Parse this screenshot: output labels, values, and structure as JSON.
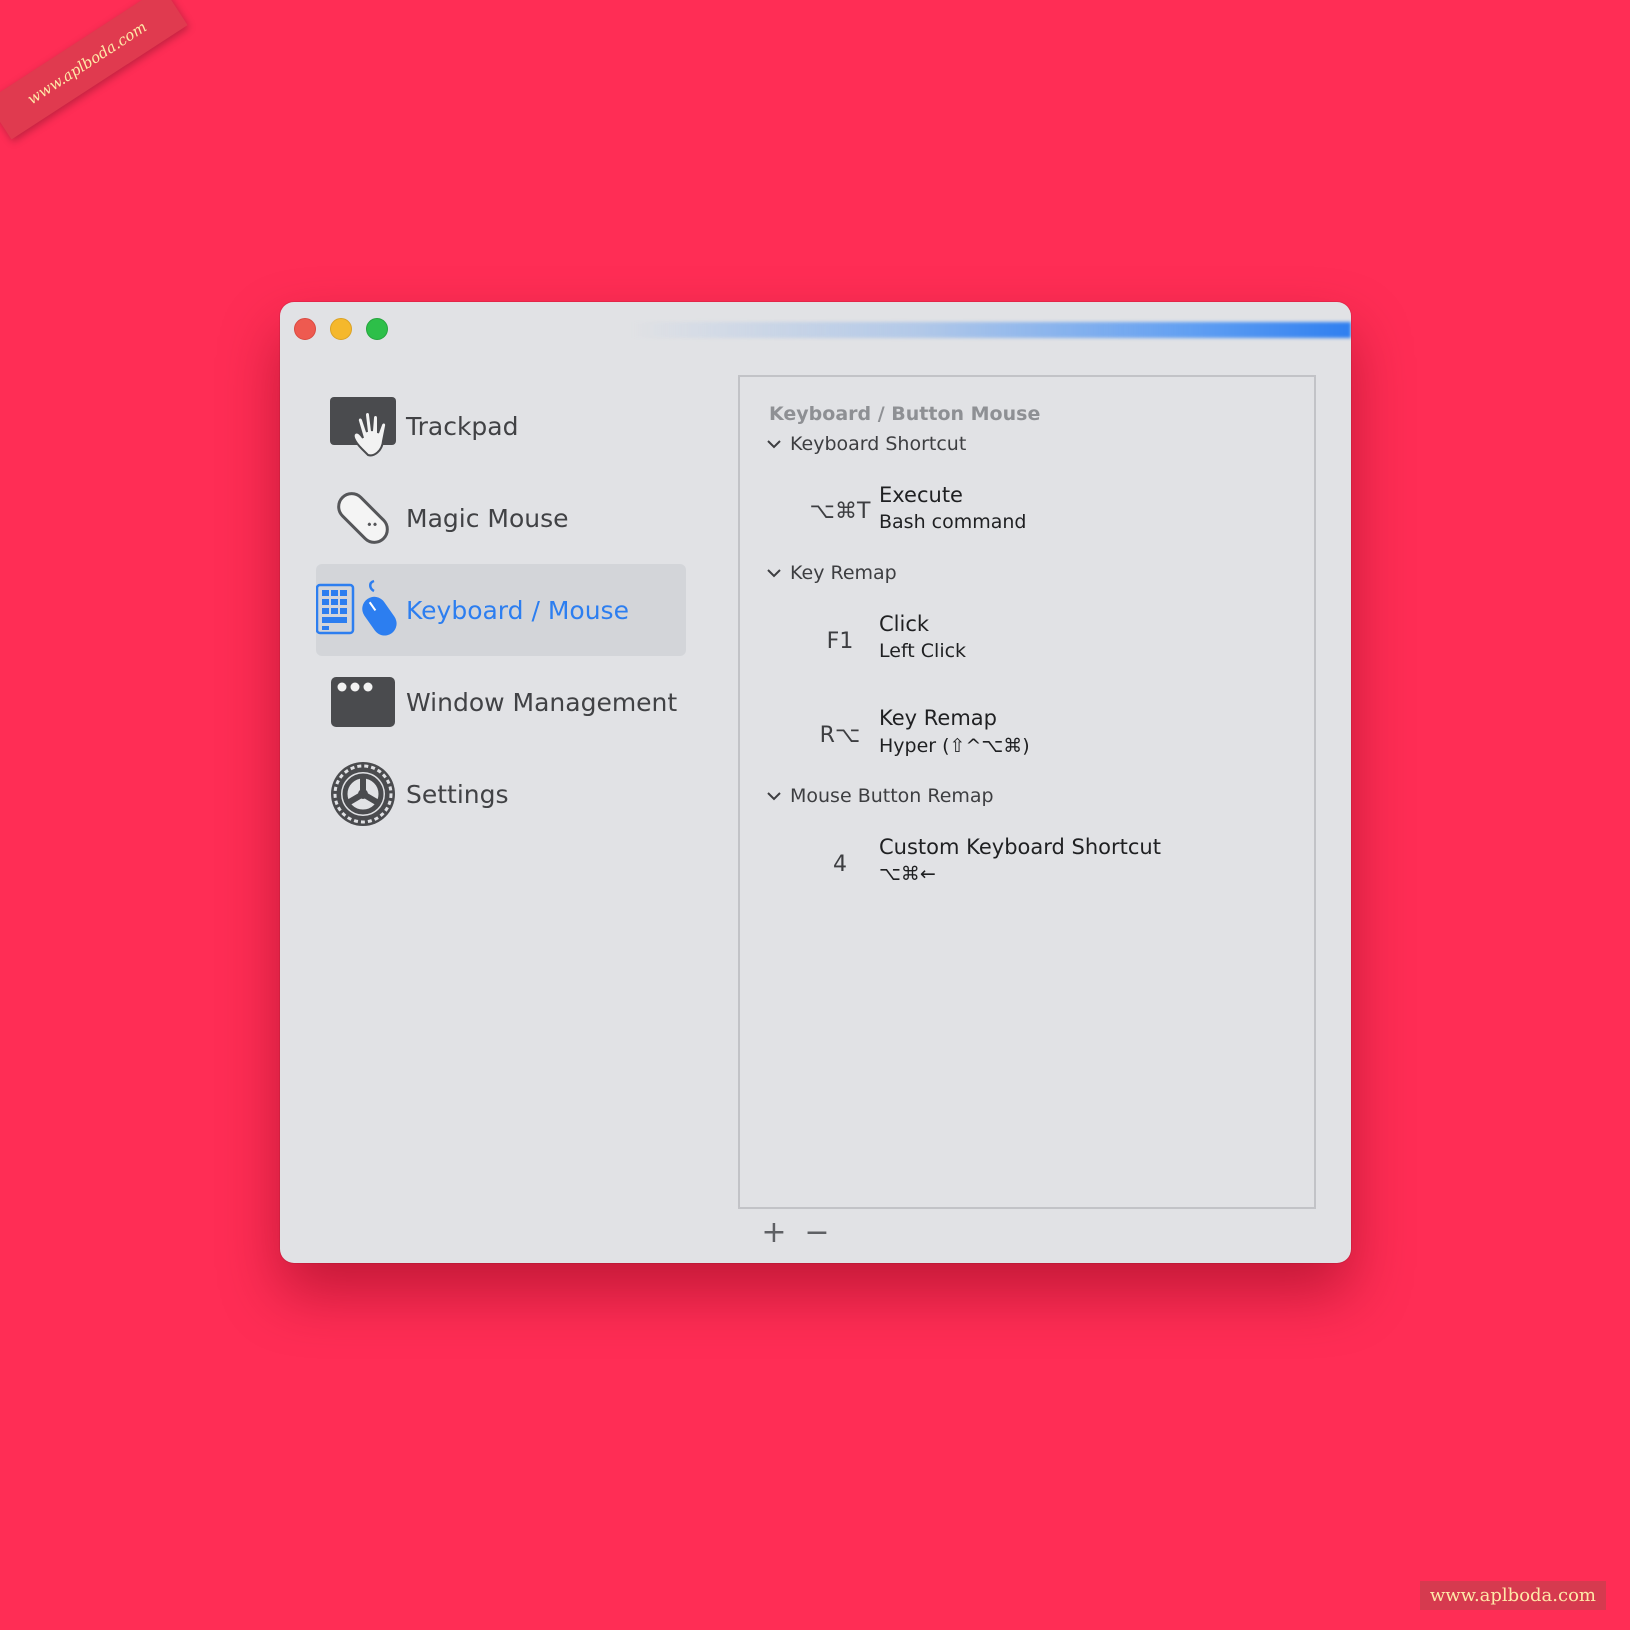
{
  "watermark": {
    "ribbon": "www.aplboda.com",
    "corner": "www.aplboda.com"
  },
  "colors": {
    "background": "#ff2d55",
    "window": "#e1e2e5",
    "accent": "#2c7ef0"
  },
  "sidebar": {
    "items": [
      {
        "label": "Trackpad",
        "icon": "trackpad-hand-icon",
        "selected": false
      },
      {
        "label": "Magic Mouse",
        "icon": "magic-mouse-icon",
        "selected": false
      },
      {
        "label": "Keyboard / Mouse",
        "icon": "keyboard-mouse-icon",
        "selected": true
      },
      {
        "label": "Window Management",
        "icon": "window-icon",
        "selected": false
      },
      {
        "label": "Settings",
        "icon": "gear-icon",
        "selected": false
      }
    ]
  },
  "panel": {
    "title": "Keyboard / Button Mouse",
    "groups": [
      {
        "header": "Keyboard Shortcut",
        "rows": [
          {
            "key": "⌥⌘T",
            "title": "Execute",
            "subtitle": "Bash command"
          }
        ]
      },
      {
        "header": "Key Remap",
        "rows": [
          {
            "key": "F1",
            "title": "Click",
            "subtitle": "Left Click"
          },
          {
            "key": "R⌥",
            "title": "Key Remap",
            "subtitle": "Hyper (⇧^⌥⌘)"
          }
        ]
      },
      {
        "header": "Mouse Button Remap",
        "rows": [
          {
            "key": "4",
            "title": "Custom Keyboard Shortcut",
            "subtitle": "⌥⌘←"
          }
        ]
      }
    ]
  },
  "footer": {
    "add_label": "+",
    "remove_label": "−"
  }
}
